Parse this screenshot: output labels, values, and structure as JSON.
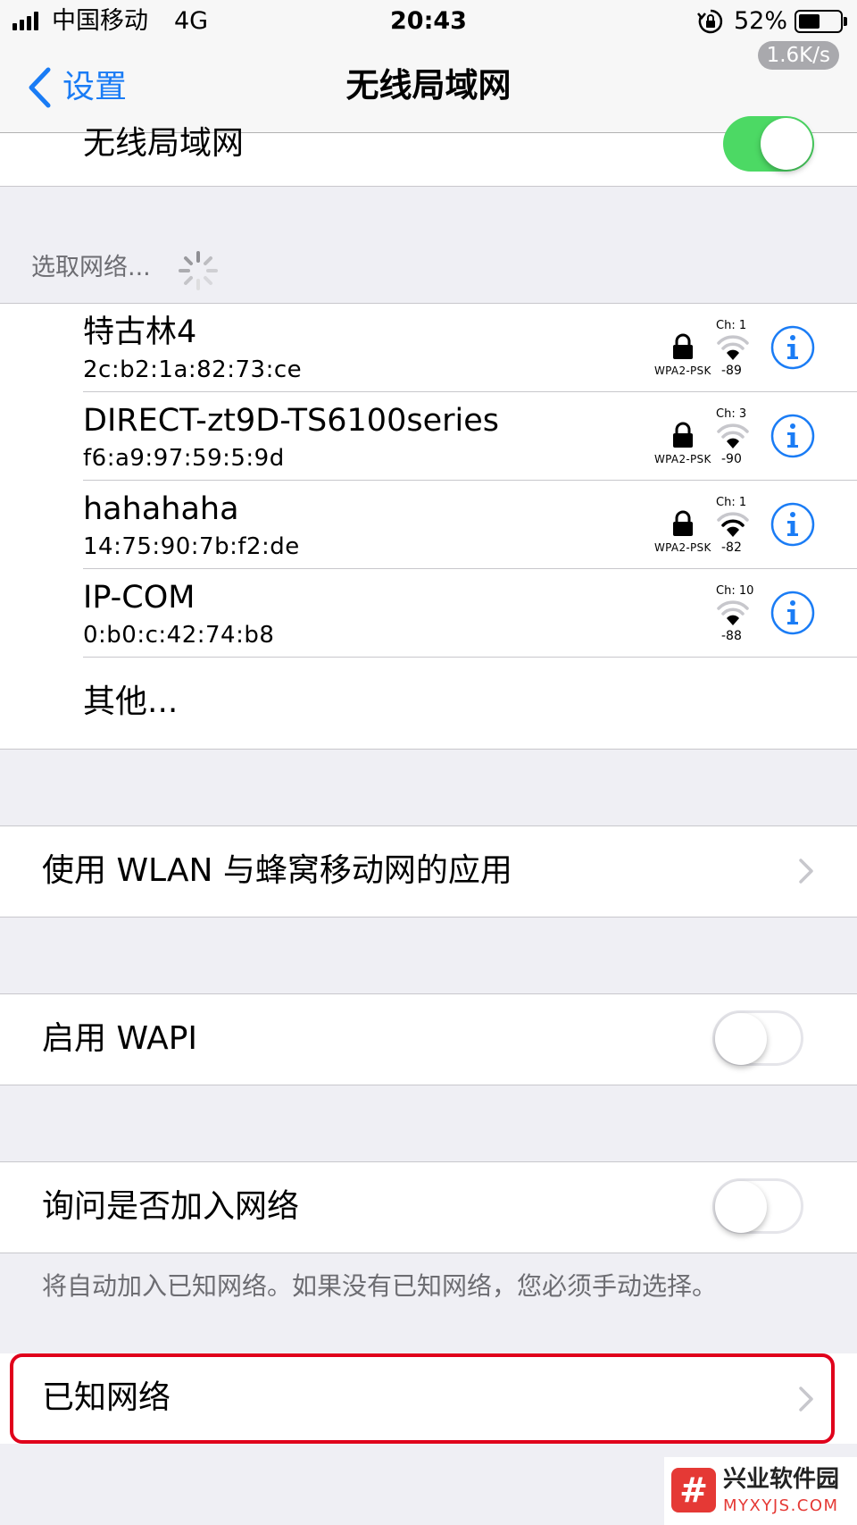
{
  "status_bar": {
    "carrier": "中国移动",
    "network": "4G",
    "time": "20:43",
    "battery": "52%",
    "battery_level": 0.52,
    "speed": "1.6K/s"
  },
  "nav": {
    "back_label": "设置",
    "title": "无线局域网"
  },
  "wifi_master": {
    "label": "无线局域网",
    "on": true
  },
  "choose_network": {
    "header": "选取网络..."
  },
  "networks": [
    {
      "name": "特古林4",
      "mac": "2c:b2:1a:82:73:ce",
      "security": "WPA2-PSK",
      "channel": "Ch: 1",
      "rssi": "-89",
      "locked": true
    },
    {
      "name": "DIRECT-zt9D-TS6100series",
      "mac": "f6:a9:97:59:5:9d",
      "security": "WPA2-PSK",
      "channel": "Ch: 3",
      "rssi": "-90",
      "locked": true
    },
    {
      "name": "hahahaha",
      "mac": "14:75:90:7b:f2:de",
      "security": "WPA2-PSK",
      "channel": "Ch: 1",
      "rssi": "-82",
      "locked": true
    },
    {
      "name": "IP-COM",
      "mac": "0:b0:c:42:74:b8",
      "security": "",
      "channel": "Ch: 10",
      "rssi": "-88",
      "locked": false
    }
  ],
  "other_label": "其他...",
  "apps_row": {
    "label": "使用 WLAN 与蜂窝移动网的应用"
  },
  "wapi_row": {
    "label": "启用 WAPI",
    "on": false
  },
  "ask_join_row": {
    "label": "询问是否加入网络",
    "on": false
  },
  "ask_join_note": "将自动加入已知网络。如果没有已知网络，您必须手动选择。",
  "known_networks_row": {
    "label": "已知网络"
  },
  "watermark": {
    "cn": "兴业软件园",
    "en": "MYXYJS.COM"
  },
  "colors": {
    "accent_blue": "#1a7cf5",
    "toggle_on": "#4cd964",
    "highlight_red": "#e0001b",
    "background": "#efeff4",
    "watermark_red": "#e53935"
  }
}
